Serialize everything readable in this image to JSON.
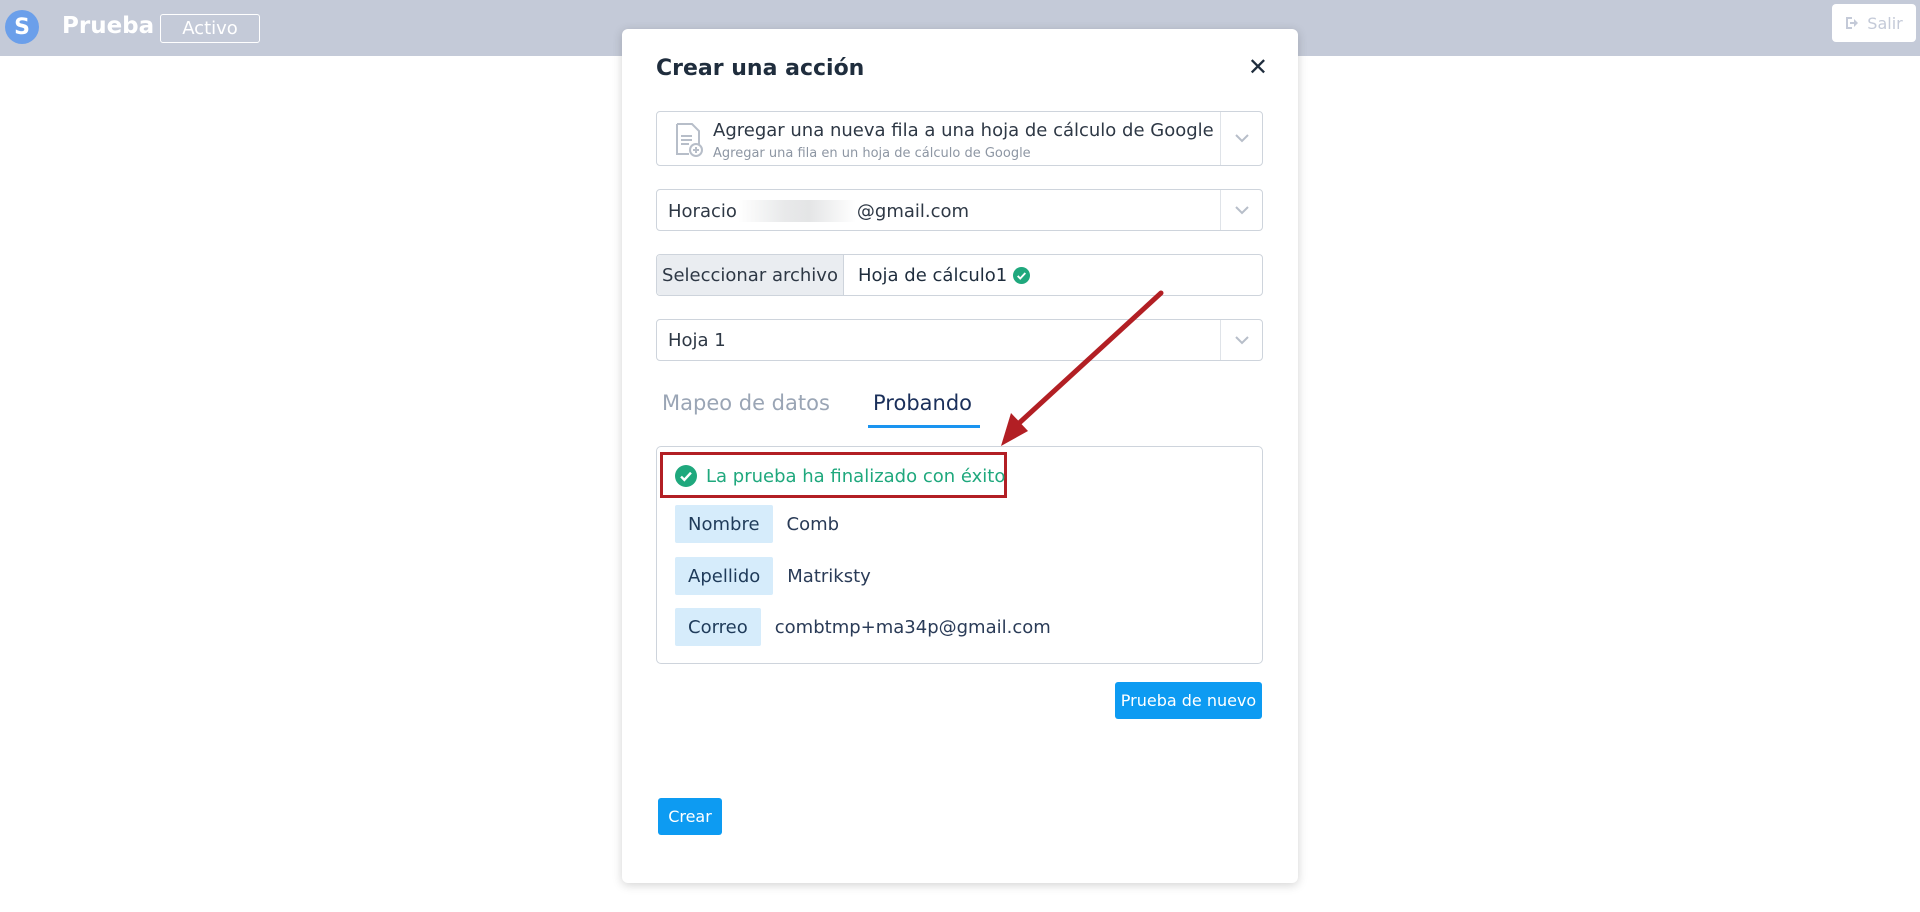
{
  "header": {
    "logo_letter": "S",
    "app_title": "Prueba",
    "status": "Activo",
    "logout_label": "Salir"
  },
  "modal": {
    "title": "Crear una acción",
    "action": {
      "title": "Agregar una nueva fila a una hoja de cálculo de Google",
      "subtitle": "Agregar una fila en un hoja de cálculo de Google"
    },
    "account": {
      "prefix": "Horacio",
      "suffix": "@gmail.com"
    },
    "file": {
      "button_label": "Seleccionar archivo",
      "selected": "Hoja de cálculo1"
    },
    "sheet": "Hoja 1",
    "tabs": [
      {
        "label": "Mapeo de datos",
        "active": false
      },
      {
        "label": "Probando",
        "active": true
      }
    ],
    "result": {
      "message": "La prueba ha finalizado con éxito",
      "fields": [
        {
          "label": "Nombre",
          "value": "Comb"
        },
        {
          "label": "Apellido",
          "value": "Matriksty"
        },
        {
          "label": "Correo",
          "value": "combtmp+ma34p@gmail.com"
        }
      ]
    },
    "retry_label": "Prueba de nuevo",
    "create_label": "Crear"
  },
  "colors": {
    "accent": "#0d9bf2",
    "success": "#1fa87d",
    "annotation": "#b21f24",
    "topbar": "#c4cad8"
  }
}
